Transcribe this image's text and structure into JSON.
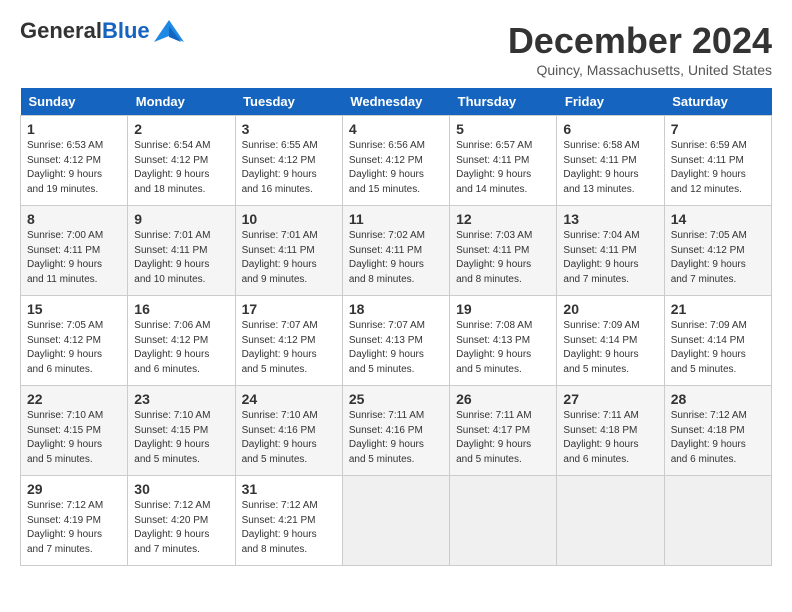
{
  "header": {
    "logo_general": "General",
    "logo_blue": "Blue",
    "month_title": "December 2024",
    "location": "Quincy, Massachusetts, United States"
  },
  "days_of_week": [
    "Sunday",
    "Monday",
    "Tuesday",
    "Wednesday",
    "Thursday",
    "Friday",
    "Saturday"
  ],
  "weeks": [
    [
      {
        "day": "1",
        "sunrise": "Sunrise: 6:53 AM",
        "sunset": "Sunset: 4:12 PM",
        "daylight": "Daylight: 9 hours and 19 minutes."
      },
      {
        "day": "2",
        "sunrise": "Sunrise: 6:54 AM",
        "sunset": "Sunset: 4:12 PM",
        "daylight": "Daylight: 9 hours and 18 minutes."
      },
      {
        "day": "3",
        "sunrise": "Sunrise: 6:55 AM",
        "sunset": "Sunset: 4:12 PM",
        "daylight": "Daylight: 9 hours and 16 minutes."
      },
      {
        "day": "4",
        "sunrise": "Sunrise: 6:56 AM",
        "sunset": "Sunset: 4:12 PM",
        "daylight": "Daylight: 9 hours and 15 minutes."
      },
      {
        "day": "5",
        "sunrise": "Sunrise: 6:57 AM",
        "sunset": "Sunset: 4:11 PM",
        "daylight": "Daylight: 9 hours and 14 minutes."
      },
      {
        "day": "6",
        "sunrise": "Sunrise: 6:58 AM",
        "sunset": "Sunset: 4:11 PM",
        "daylight": "Daylight: 9 hours and 13 minutes."
      },
      {
        "day": "7",
        "sunrise": "Sunrise: 6:59 AM",
        "sunset": "Sunset: 4:11 PM",
        "daylight": "Daylight: 9 hours and 12 minutes."
      }
    ],
    [
      {
        "day": "8",
        "sunrise": "Sunrise: 7:00 AM",
        "sunset": "Sunset: 4:11 PM",
        "daylight": "Daylight: 9 hours and 11 minutes."
      },
      {
        "day": "9",
        "sunrise": "Sunrise: 7:01 AM",
        "sunset": "Sunset: 4:11 PM",
        "daylight": "Daylight: 9 hours and 10 minutes."
      },
      {
        "day": "10",
        "sunrise": "Sunrise: 7:01 AM",
        "sunset": "Sunset: 4:11 PM",
        "daylight": "Daylight: 9 hours and 9 minutes."
      },
      {
        "day": "11",
        "sunrise": "Sunrise: 7:02 AM",
        "sunset": "Sunset: 4:11 PM",
        "daylight": "Daylight: 9 hours and 8 minutes."
      },
      {
        "day": "12",
        "sunrise": "Sunrise: 7:03 AM",
        "sunset": "Sunset: 4:11 PM",
        "daylight": "Daylight: 9 hours and 8 minutes."
      },
      {
        "day": "13",
        "sunrise": "Sunrise: 7:04 AM",
        "sunset": "Sunset: 4:11 PM",
        "daylight": "Daylight: 9 hours and 7 minutes."
      },
      {
        "day": "14",
        "sunrise": "Sunrise: 7:05 AM",
        "sunset": "Sunset: 4:12 PM",
        "daylight": "Daylight: 9 hours and 7 minutes."
      }
    ],
    [
      {
        "day": "15",
        "sunrise": "Sunrise: 7:05 AM",
        "sunset": "Sunset: 4:12 PM",
        "daylight": "Daylight: 9 hours and 6 minutes."
      },
      {
        "day": "16",
        "sunrise": "Sunrise: 7:06 AM",
        "sunset": "Sunset: 4:12 PM",
        "daylight": "Daylight: 9 hours and 6 minutes."
      },
      {
        "day": "17",
        "sunrise": "Sunrise: 7:07 AM",
        "sunset": "Sunset: 4:12 PM",
        "daylight": "Daylight: 9 hours and 5 minutes."
      },
      {
        "day": "18",
        "sunrise": "Sunrise: 7:07 AM",
        "sunset": "Sunset: 4:13 PM",
        "daylight": "Daylight: 9 hours and 5 minutes."
      },
      {
        "day": "19",
        "sunrise": "Sunrise: 7:08 AM",
        "sunset": "Sunset: 4:13 PM",
        "daylight": "Daylight: 9 hours and 5 minutes."
      },
      {
        "day": "20",
        "sunrise": "Sunrise: 7:09 AM",
        "sunset": "Sunset: 4:14 PM",
        "daylight": "Daylight: 9 hours and 5 minutes."
      },
      {
        "day": "21",
        "sunrise": "Sunrise: 7:09 AM",
        "sunset": "Sunset: 4:14 PM",
        "daylight": "Daylight: 9 hours and 5 minutes."
      }
    ],
    [
      {
        "day": "22",
        "sunrise": "Sunrise: 7:10 AM",
        "sunset": "Sunset: 4:15 PM",
        "daylight": "Daylight: 9 hours and 5 minutes."
      },
      {
        "day": "23",
        "sunrise": "Sunrise: 7:10 AM",
        "sunset": "Sunset: 4:15 PM",
        "daylight": "Daylight: 9 hours and 5 minutes."
      },
      {
        "day": "24",
        "sunrise": "Sunrise: 7:10 AM",
        "sunset": "Sunset: 4:16 PM",
        "daylight": "Daylight: 9 hours and 5 minutes."
      },
      {
        "day": "25",
        "sunrise": "Sunrise: 7:11 AM",
        "sunset": "Sunset: 4:16 PM",
        "daylight": "Daylight: 9 hours and 5 minutes."
      },
      {
        "day": "26",
        "sunrise": "Sunrise: 7:11 AM",
        "sunset": "Sunset: 4:17 PM",
        "daylight": "Daylight: 9 hours and 5 minutes."
      },
      {
        "day": "27",
        "sunrise": "Sunrise: 7:11 AM",
        "sunset": "Sunset: 4:18 PM",
        "daylight": "Daylight: 9 hours and 6 minutes."
      },
      {
        "day": "28",
        "sunrise": "Sunrise: 7:12 AM",
        "sunset": "Sunset: 4:18 PM",
        "daylight": "Daylight: 9 hours and 6 minutes."
      }
    ],
    [
      {
        "day": "29",
        "sunrise": "Sunrise: 7:12 AM",
        "sunset": "Sunset: 4:19 PM",
        "daylight": "Daylight: 9 hours and 7 minutes."
      },
      {
        "day": "30",
        "sunrise": "Sunrise: 7:12 AM",
        "sunset": "Sunset: 4:20 PM",
        "daylight": "Daylight: 9 hours and 7 minutes."
      },
      {
        "day": "31",
        "sunrise": "Sunrise: 7:12 AM",
        "sunset": "Sunset: 4:21 PM",
        "daylight": "Daylight: 9 hours and 8 minutes."
      },
      null,
      null,
      null,
      null
    ]
  ]
}
